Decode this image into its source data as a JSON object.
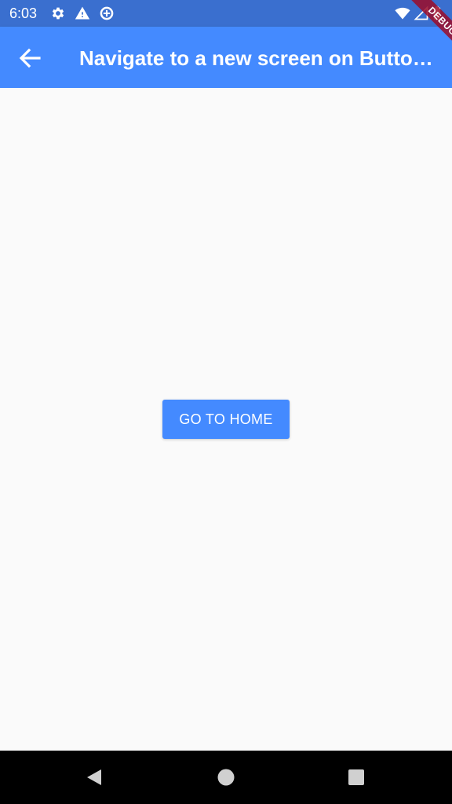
{
  "status_bar": {
    "time": "6:03",
    "icons": [
      "gear-icon",
      "warning-icon",
      "data-saver-icon",
      "wifi-icon",
      "signal-icon",
      "battery-icon"
    ],
    "background": "#3a6fcf"
  },
  "app_bar": {
    "title": "Navigate to a new screen on Butto…",
    "back_icon": "arrow-back-icon",
    "background": "#448aff"
  },
  "debug_banner": {
    "label": "DEBUG"
  },
  "main": {
    "button_label": "GO TO HOME",
    "button_color": "#448aff"
  },
  "nav_bar": {
    "buttons": [
      "back-triangle-icon",
      "home-circle-icon",
      "recents-square-icon"
    ]
  }
}
